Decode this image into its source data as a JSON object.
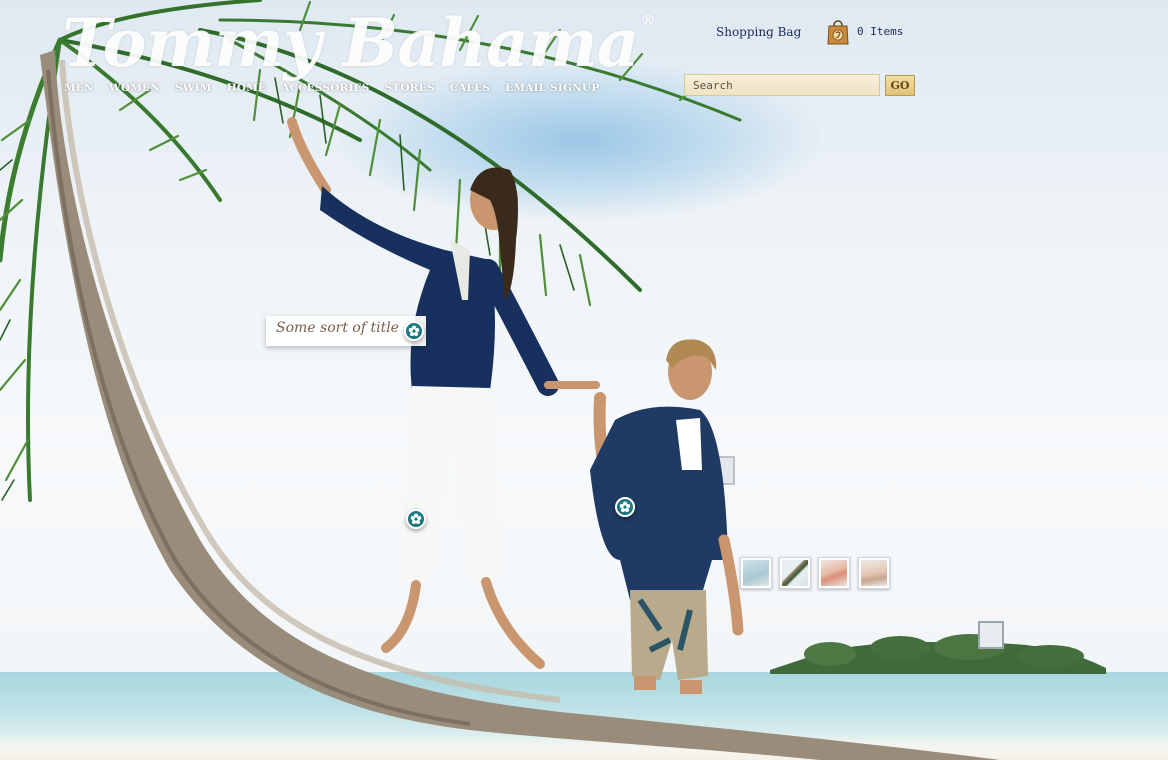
{
  "brand": {
    "logo_text": "Tommy Bahama",
    "registered_mark": "®"
  },
  "nav": {
    "items": [
      {
        "label": "MEN"
      },
      {
        "label": "WOMEN"
      },
      {
        "label": "SWIM"
      },
      {
        "label": "HOME"
      },
      {
        "label": "ACCESSORIES"
      },
      {
        "label": "STORES"
      },
      {
        "label": "CAFES"
      },
      {
        "label": "EMAIL SIGNUP"
      }
    ]
  },
  "header": {
    "shopping_bag_label": "Shopping Bag",
    "bag_count_text": "0 Items",
    "search_placeholder": "Search",
    "go_label": "GO"
  },
  "hero": {
    "title_tag_text": "Some sort of title",
    "hotspot_icon": "hibiscus-flower-icon",
    "thumbnail_count": 4
  },
  "colors": {
    "navy_text": "#1b2a56",
    "hotspot_teal": "#1c6f78",
    "search_bg": "#f2e8cd",
    "go_button": "#e8cd86",
    "title_tag_text": "#7a5c4c"
  }
}
